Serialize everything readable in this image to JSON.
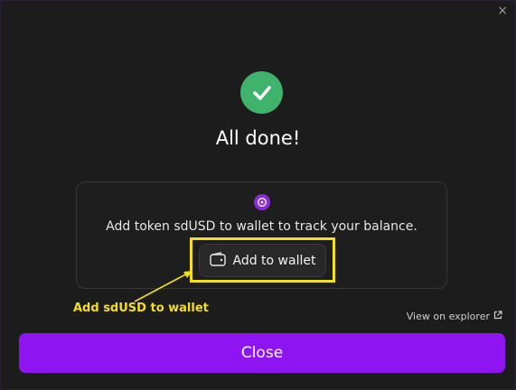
{
  "modal": {
    "close_glyph": "×",
    "title": "All done!",
    "success_icon": "checkmark-icon",
    "success_color": "#3fb26b"
  },
  "token_card": {
    "token_icon": "token-logo-icon",
    "message": "Add token sdUSD to wallet to track your balance.",
    "add_button_label": "Add to wallet",
    "add_button_icon": "wallet-icon"
  },
  "annotation": {
    "label": "Add sdUSD to wallet",
    "color": "#f4de20"
  },
  "explorer_link": {
    "label": "View on explorer",
    "icon": "external-link-icon"
  },
  "footer": {
    "close_label": "Close",
    "accent_color": "#8e14f2"
  }
}
